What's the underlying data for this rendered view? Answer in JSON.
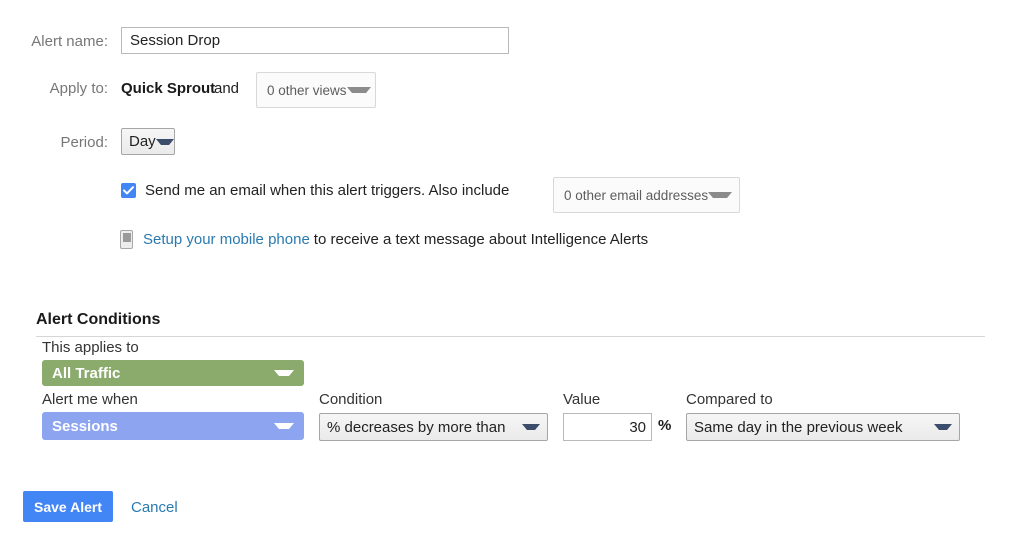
{
  "form": {
    "alert_name": {
      "label": "Alert name:",
      "value": "Session Drop"
    },
    "apply_to": {
      "label": "Apply to:",
      "profile": "Quick Sprout",
      "conjunction": "and",
      "views_select": "0 other views"
    },
    "period": {
      "label": "Period:",
      "value": "Day"
    },
    "email_notification": {
      "checked": true,
      "label": "Send me an email when this alert triggers. Also include",
      "emails_select": "0 other email addresses"
    },
    "mobile_notification": {
      "link_text": "Setup your mobile phone",
      "trailing_text": "to receive a text message about Intelligence Alerts"
    }
  },
  "alert_conditions": {
    "heading": "Alert Conditions",
    "applies_to": {
      "label": "This applies to",
      "value": "All Traffic"
    },
    "alert_me_when": {
      "label": "Alert me when",
      "value": "Sessions"
    },
    "condition": {
      "label": "Condition",
      "value": "% decreases by more than"
    },
    "value": {
      "label": "Value",
      "amount": "30",
      "unit": "%"
    },
    "compared_to": {
      "label": "Compared to",
      "value": "Same day in the previous week"
    }
  },
  "footer": {
    "save_label": "Save Alert",
    "cancel_label": "Cancel"
  },
  "colors": {
    "primary_blue": "#4285f4",
    "link_blue": "#2a7ab0",
    "dimension_green": "#8aab6b",
    "metric_blue": "#8da4f0"
  }
}
